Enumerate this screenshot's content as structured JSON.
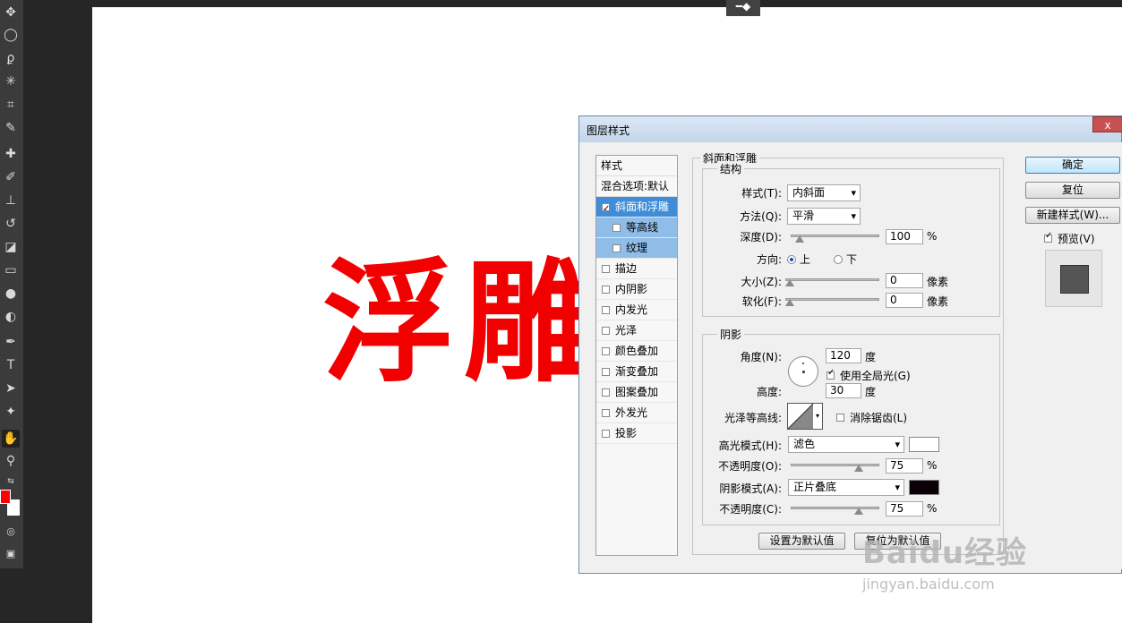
{
  "toolbar": {
    "tools": [
      "move-tool-icon",
      "ellipse-marquee-icon",
      "lasso-icon",
      "magic-wand-icon",
      "crop-icon",
      "eyedropper-icon",
      "healing-brush-icon",
      "brush-icon",
      "stamp-icon",
      "history-brush-icon",
      "eraser-icon",
      "gradient-icon",
      "blur-icon",
      "dodge-icon",
      "pen-icon",
      "text-icon",
      "path-select-icon",
      "shape-icon",
      "hand-icon",
      "zoom-icon"
    ],
    "foreground_color": "#ff0000",
    "background_color": "#ffffff"
  },
  "canvas": {
    "text": "浮雕",
    "text_color": "#f20000"
  },
  "dialog": {
    "title": "图层样式",
    "close_label": "x",
    "styles_header": "样式",
    "blending_options": "混合选项:默认",
    "style_items": [
      {
        "label": "斜面和浮雕",
        "checked": true
      },
      {
        "label": "等高线",
        "checked": false
      },
      {
        "label": "纹理",
        "checked": false
      },
      {
        "label": "描边",
        "checked": false
      },
      {
        "label": "内阴影",
        "checked": false
      },
      {
        "label": "内发光",
        "checked": false
      },
      {
        "label": "光泽",
        "checked": false
      },
      {
        "label": "颜色叠加",
        "checked": false
      },
      {
        "label": "渐变叠加",
        "checked": false
      },
      {
        "label": "图案叠加",
        "checked": false
      },
      {
        "label": "外发光",
        "checked": false
      },
      {
        "label": "投影",
        "checked": false
      }
    ],
    "bevel": {
      "section_title": "斜面和浮雕",
      "structure_title": "结构",
      "style_label": "样式(T):",
      "style_value": "内斜面",
      "technique_label": "方法(Q):",
      "technique_value": "平滑",
      "depth_label": "深度(D):",
      "depth_value": "100",
      "depth_unit": "%",
      "direction_label": "方向:",
      "direction_up": "上",
      "direction_down": "下",
      "size_label": "大小(Z):",
      "size_value": "0",
      "size_unit": "像素",
      "soften_label": "软化(F):",
      "soften_value": "0",
      "soften_unit": "像素"
    },
    "shading": {
      "title": "阴影",
      "angle_label": "角度(N):",
      "angle_value": "120",
      "angle_unit": "度",
      "global_light_label": "使用全局光(G)",
      "global_light_checked": true,
      "altitude_label": "高度:",
      "altitude_value": "30",
      "altitude_unit": "度",
      "gloss_label": "光泽等高线:",
      "antialias_label": "消除锯齿(L)",
      "highlight_mode_label": "高光模式(H):",
      "highlight_mode_value": "滤色",
      "highlight_color": "#ffffff",
      "highlight_opacity_label": "不透明度(O):",
      "highlight_opacity_value": "75",
      "shadow_mode_label": "阴影模式(A):",
      "shadow_mode_value": "正片叠底",
      "shadow_color": "#0a0006",
      "shadow_opacity_label": "不透明度(C):",
      "shadow_opacity_value": "75",
      "percent": "%"
    },
    "buttons": {
      "set_default": "设置为默认值",
      "reset_default": "复位为默认值",
      "ok": "确定",
      "reset": "复位",
      "new_style": "新建样式(W)...",
      "preview_label": "预览(V)"
    }
  },
  "watermark": {
    "brand": "Baidu经验",
    "url": "jingyan.baidu.com"
  }
}
